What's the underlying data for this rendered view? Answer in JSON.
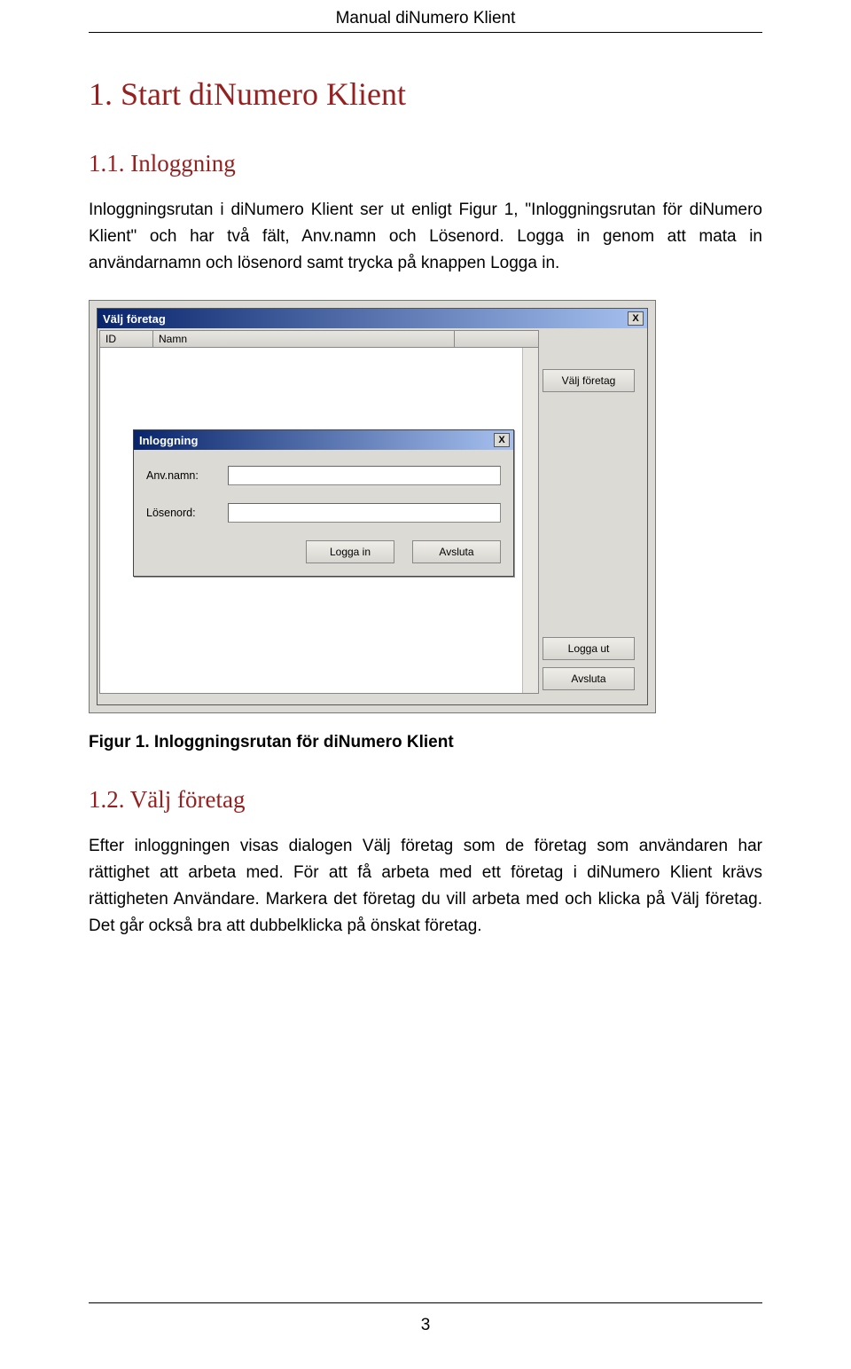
{
  "header": {
    "title": "Manual diNumero Klient"
  },
  "section1": {
    "heading": "1. Start diNumero Klient",
    "sub1": {
      "heading": "1.1. Inloggning",
      "para": "Inloggningsrutan i diNumero Klient ser ut enligt Figur 1, \"Inloggningsrutan för diNumero Klient\" och har två fält, Anv.namn och Lösenord. Logga in genom att mata in användarnamn och lösenord samt trycka på knappen Logga in."
    },
    "caption1": "Figur 1. Inloggningsrutan för diNumero Klient",
    "sub2": {
      "heading": "1.2. Välj företag",
      "para": "Efter inloggningen visas dialogen Välj företag som de företag som användaren har rättighet att arbeta med. För att få arbeta med ett företag i diNumero Klient krävs rättigheten Användare. Markera det företag du vill arbeta med och klicka på Välj företag. Det går också bra att dubbelklicka på önskat företag."
    }
  },
  "vf_window": {
    "title": "Välj företag",
    "close_label": "X",
    "col_id": "ID",
    "col_name": "Namn",
    "btn_select": "Välj företag",
    "btn_logout": "Logga ut",
    "btn_quit": "Avsluta"
  },
  "login_window": {
    "title": "Inloggning",
    "close_label": "X",
    "label_user": "Anv.namn:",
    "label_pass": "Lösenord:",
    "btn_login": "Logga in",
    "btn_quit": "Avsluta"
  },
  "footer": {
    "page_number": "3"
  }
}
